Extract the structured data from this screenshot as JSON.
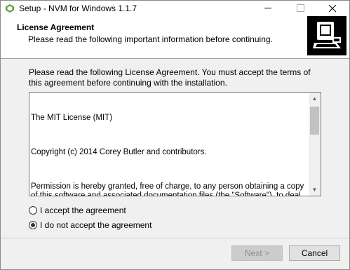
{
  "window": {
    "title": "Setup - NVM for Windows 1.1.7"
  },
  "header": {
    "title": "License Agreement",
    "subtitle": "Please read the following important information before continuing."
  },
  "body": {
    "intro": "Please read the following License Agreement. You must accept the terms of this agreement before continuing with the installation.",
    "license": {
      "heading": "The MIT License (MIT)",
      "copyright": "Copyright (c) 2014 Corey Butler and contributors.",
      "permission": "Permission is hereby granted, free of charge, to any person obtaining a copy\nof this software and associated documentation files (the \"Software\"), to deal\nin the Software without restriction, including without limitation the rights\nto use, copy, modify, merge, publish, distribute, sublicense, and/or sell\ncopies of the Software, and to permit persons to whom the Software is\nfurnished to do so, subject to the following conditions:"
    },
    "options": {
      "accept": "I accept the agreement",
      "decline": "I do not accept the agreement",
      "selected": "decline"
    }
  },
  "buttons": {
    "next": "Next >",
    "cancel": "Cancel"
  },
  "colors": {
    "window_bg": "#f0f0f0",
    "header_bg": "#ffffff",
    "disabled_text": "#8d8d8d"
  }
}
